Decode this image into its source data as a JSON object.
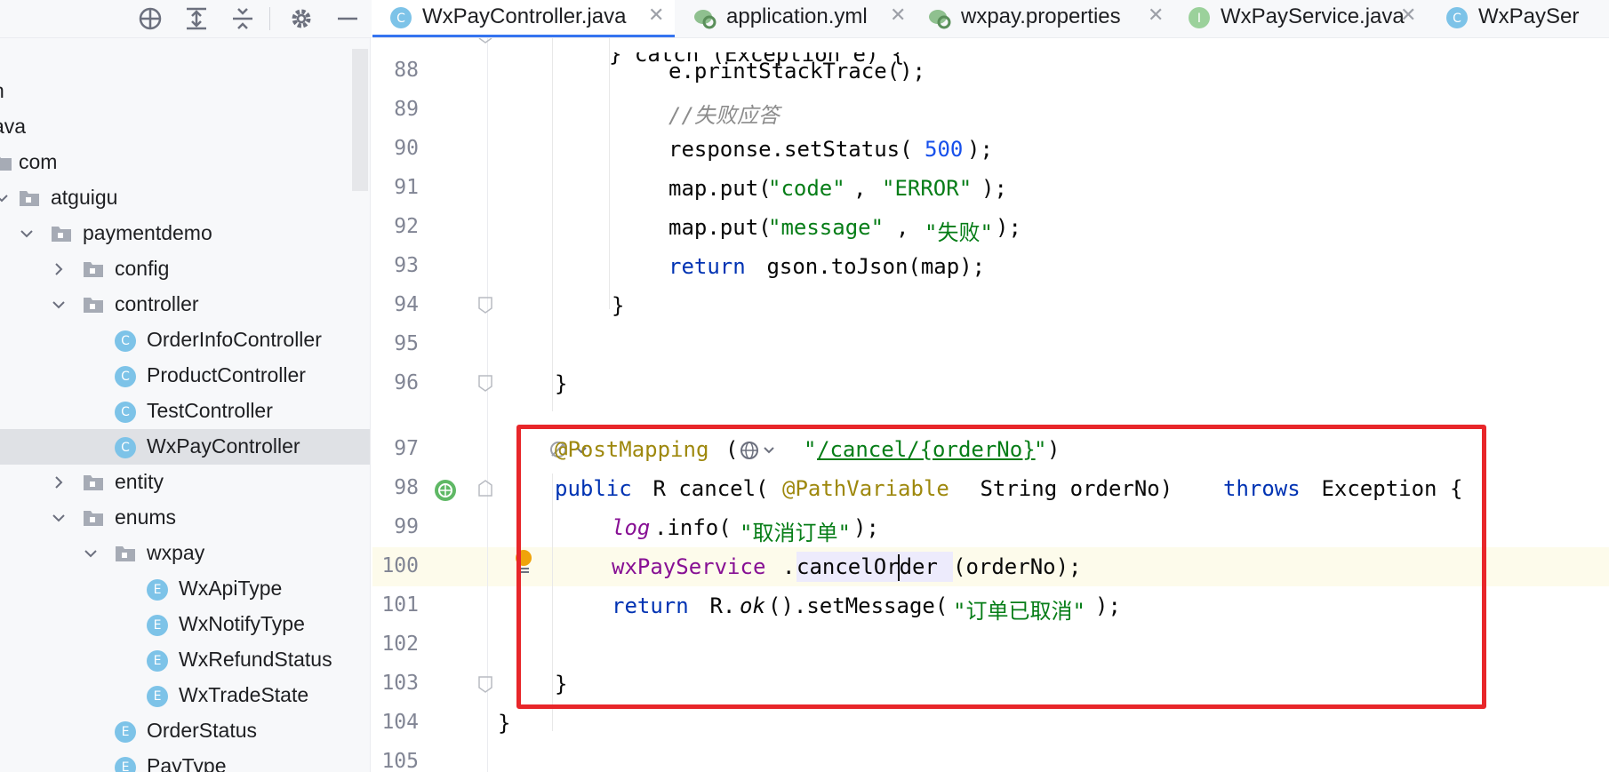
{
  "project_tree": {
    "items": [
      {
        "label": "n",
        "expanded": null,
        "kind": "text"
      },
      {
        "label": "ava",
        "expanded": null,
        "kind": "text"
      },
      {
        "label": "com",
        "expanded": true,
        "kind": "package"
      },
      {
        "label": "atguigu",
        "expanded": true,
        "kind": "package"
      },
      {
        "label": "paymentdemo",
        "expanded": true,
        "kind": "package"
      },
      {
        "label": "config",
        "expanded": false,
        "kind": "package"
      },
      {
        "label": "controller",
        "expanded": true,
        "kind": "package"
      },
      {
        "label": "OrderInfoController",
        "kind": "class",
        "badge": "C"
      },
      {
        "label": "ProductController",
        "kind": "class",
        "badge": "C"
      },
      {
        "label": "TestController",
        "kind": "class",
        "badge": "C"
      },
      {
        "label": "WxPayController",
        "kind": "class",
        "badge": "C",
        "selected": true
      },
      {
        "label": "entity",
        "expanded": false,
        "kind": "package"
      },
      {
        "label": "enums",
        "expanded": true,
        "kind": "package"
      },
      {
        "label": "wxpay",
        "expanded": true,
        "kind": "package"
      },
      {
        "label": "WxApiType",
        "kind": "enum",
        "badge": "E"
      },
      {
        "label": "WxNotifyType",
        "kind": "enum",
        "badge": "E"
      },
      {
        "label": "WxRefundStatus",
        "kind": "enum",
        "badge": "E"
      },
      {
        "label": "WxTradeState",
        "kind": "enum",
        "badge": "E"
      },
      {
        "label": "OrderStatus",
        "kind": "enum",
        "badge": "E"
      },
      {
        "label": "PayType",
        "kind": "enum",
        "badge": "E"
      }
    ]
  },
  "toolbar": {
    "icons": [
      "locate-icon",
      "expand-all-icon",
      "collapse-all-icon",
      "settings-icon",
      "hide-icon"
    ]
  },
  "tabs": [
    {
      "label": "WxPayController.java",
      "icon": "C",
      "active": true
    },
    {
      "label": "application.yml",
      "icon": "yml"
    },
    {
      "label": "wxpay.properties",
      "icon": "props"
    },
    {
      "label": "WxPayService.java",
      "icon": "I"
    },
    {
      "label": "WxPaySer",
      "icon": "C"
    }
  ],
  "editor": {
    "lines": [
      {
        "n": "88",
        "code": "e.printStackTrace();"
      },
      {
        "n": "89",
        "code": "//失败应答"
      },
      {
        "n": "90",
        "code": "response.setStatus(500);"
      },
      {
        "n": "91",
        "code": "map.put(\"code\", \"ERROR\");"
      },
      {
        "n": "92",
        "code": "map.put(\"message\", \"失败\");"
      },
      {
        "n": "93",
        "code": "return gson.toJson(map);"
      },
      {
        "n": "94",
        "code": "}"
      },
      {
        "n": "95",
        "code": ""
      },
      {
        "n": "96",
        "code": "}"
      },
      {
        "n": "97",
        "code": "@PostMapping(\"/cancel/{orderNo}\")"
      },
      {
        "n": "98",
        "code": "public R cancel(@PathVariable String orderNo) throws Exception {"
      },
      {
        "n": "99",
        "code": "log.info(\"取消订单\");"
      },
      {
        "n": "100",
        "code": "wxPayService.cancelOrder(orderNo);"
      },
      {
        "n": "101",
        "code": "return R.ok().setMessage(\"订单已取消\");"
      },
      {
        "n": "102",
        "code": ""
      },
      {
        "n": "103",
        "code": "}"
      },
      {
        "n": "104",
        "code": "}"
      },
      {
        "n": "105",
        "code": ""
      }
    ],
    "tokens": {
      "l88": "e.printStackTrace();",
      "l89": "//失败应答",
      "l90a": "response.setStatus(",
      "l90b": "500",
      "l90c": ");",
      "l91a": "map.put(",
      "l91b": "\"code\"",
      "l91c": ", ",
      "l91d": "\"ERROR\"",
      "l91e": ");",
      "l92a": "map.put(",
      "l92b": "\"message\"",
      "l92c": ", ",
      "l92d": "\"失败\"",
      "l92e": ");",
      "l93a": "return",
      "l93b": " gson.toJson(map);",
      "brace": "}",
      "l97a": "@PostMapping",
      "l97b": "(",
      "l97c": "\"",
      "l97d": "/cancel/{orderNo}",
      "l97e": "\"",
      "l97f": ")",
      "l98a": "public",
      "l98b": " R cancel(",
      "l98c": "@PathVariable",
      "l98d": " String orderNo) ",
      "l98e": "throws",
      "l98f": " Exception {",
      "l99a": "log",
      "l99b": ".info(",
      "l99c": "\"取消订单\"",
      "l99d": ");",
      "l100a": "wxPayService",
      "l100b": ".",
      "l100c": "cancelOrder",
      "l100d": "(orderNo);",
      "l101a": "return",
      "l101b": " R.",
      "l101c": "ok",
      "l101d": "().setMessage(",
      "l101e": "\"订单已取消\"",
      "l101f": ");",
      "l87": "} catch (Exception e) {"
    }
  },
  "colors": {
    "highlight_box": "#e8262a",
    "keyword": "#0033b3",
    "string": "#067d17",
    "number": "#1750eb",
    "annotation": "#9e880d",
    "field": "#871094",
    "tab_accent": "#3574f0"
  }
}
